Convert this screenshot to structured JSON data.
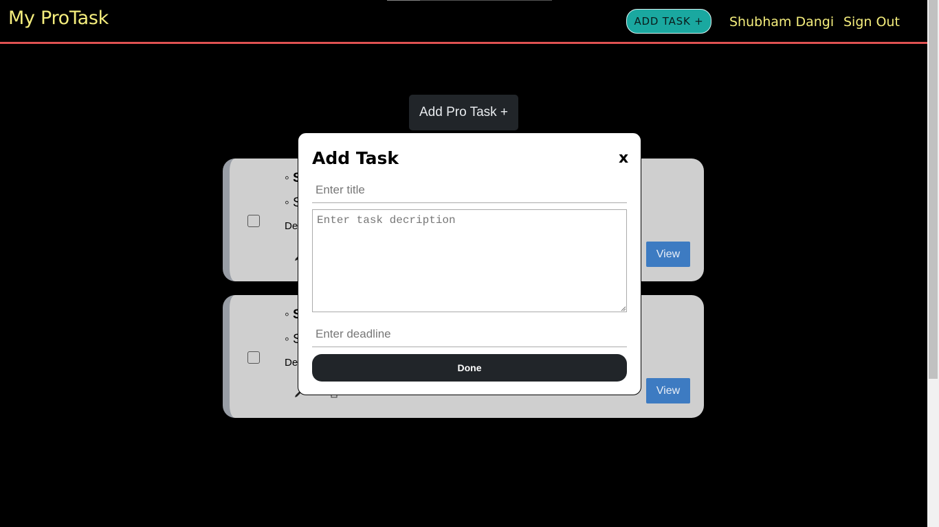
{
  "navbar": {
    "brand": "My ProTask",
    "add_task_label": "ADD TASK +",
    "user_name": "Shubham Dangi",
    "sign_out_label": "Sign Out"
  },
  "main": {
    "add_pro_task_label": "Add Pro Task +"
  },
  "tasks": [
    {
      "title_visible": "◦ S",
      "subtitle_visible": "◦ S",
      "deadline_visible": "De",
      "view_label": "View",
      "edit_icon": "pencil-icon",
      "delete_icon": "trash-icon"
    },
    {
      "title_visible": "◦ S",
      "subtitle_visible": "◦ S",
      "deadline_visible": "De",
      "view_label": "View",
      "edit_icon": "pencil-icon",
      "delete_icon": "trash-icon"
    }
  ],
  "modal": {
    "title": "Add Task",
    "close_label": "x",
    "title_placeholder": "Enter title",
    "description_placeholder": "Enter task decription",
    "deadline_placeholder": "Enter deadline",
    "done_label": "Done"
  },
  "colors": {
    "brand_yellow": "#f5ee7d",
    "nav_border": "#e05252",
    "add_task_teal": "#1aa8a0",
    "view_blue": "#3d7bc2",
    "dark_button": "#212529",
    "card_bg": "#cfcfcf"
  }
}
